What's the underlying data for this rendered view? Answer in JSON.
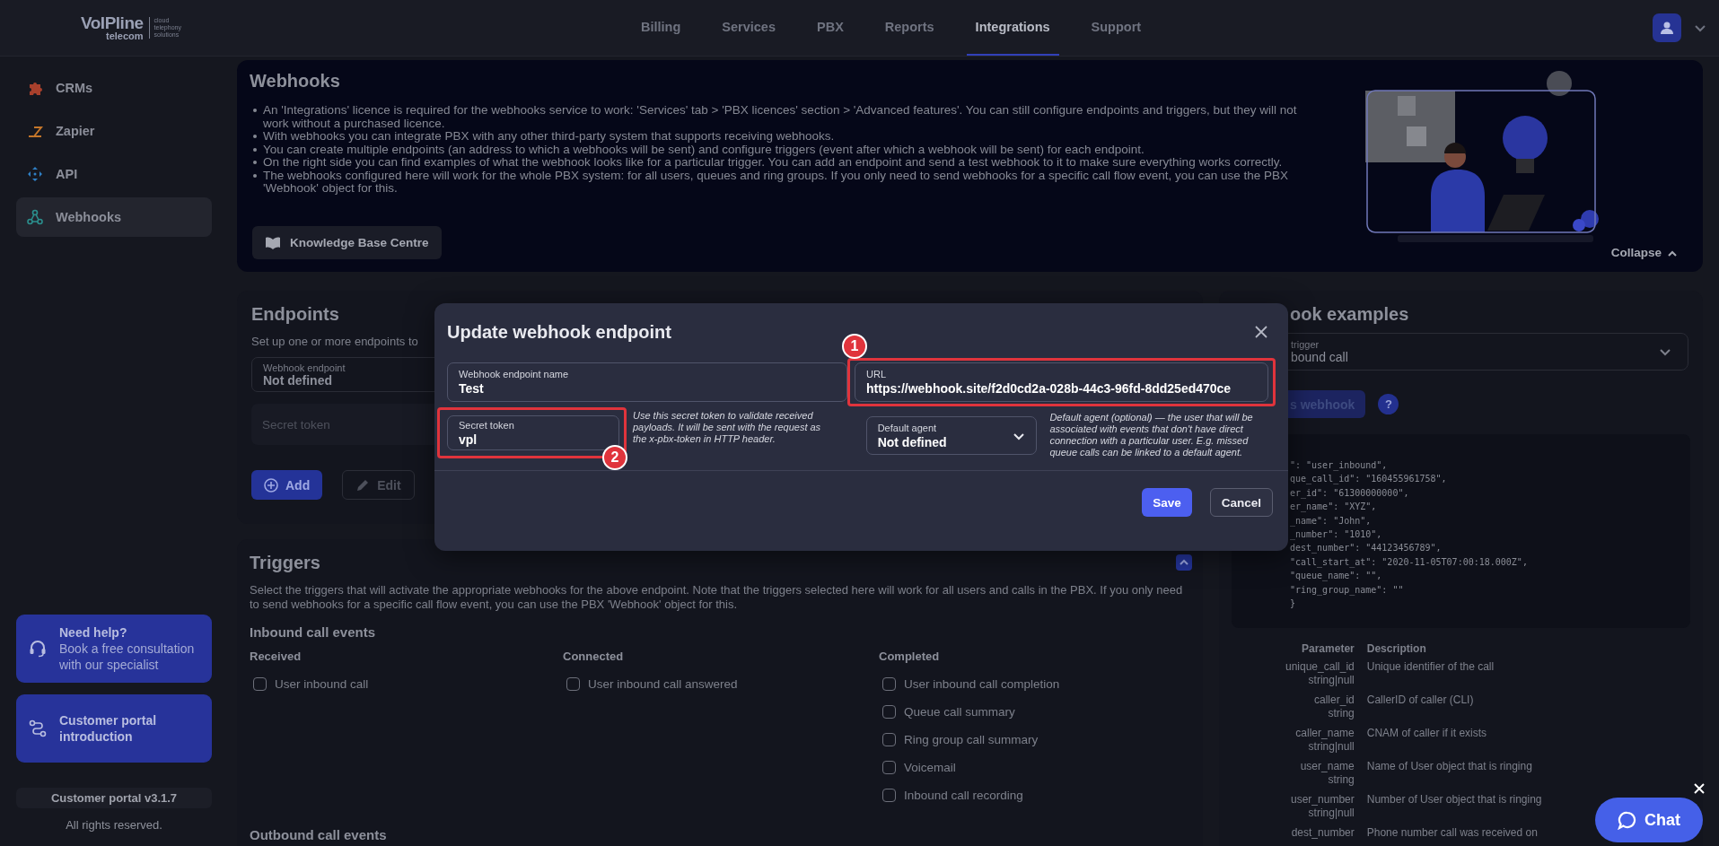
{
  "header": {
    "logo": {
      "name": "VoIPline",
      "sub": "telecom",
      "tagline": "cloud telephony solutions"
    },
    "nav": [
      {
        "label": "Billing",
        "selected": false
      },
      {
        "label": "Services",
        "selected": false
      },
      {
        "label": "PBX",
        "selected": false
      },
      {
        "label": "Reports",
        "selected": false
      },
      {
        "label": "Integrations",
        "selected": true
      },
      {
        "label": "Support",
        "selected": false
      }
    ]
  },
  "sidebar": {
    "items": [
      {
        "label": "CRMs",
        "kind": "puzzle",
        "selected": false
      },
      {
        "label": "Zapier",
        "kind": "zigzag",
        "selected": false
      },
      {
        "label": "API",
        "kind": "arrows",
        "selected": false
      },
      {
        "label": "Webhooks",
        "kind": "nodes",
        "selected": true
      }
    ],
    "help_card": {
      "title": "Need help?",
      "text": "Book a free consultation with our specialist"
    },
    "intro_card": {
      "title": "Customer portal introduction"
    },
    "version": "Customer portal v3.1.7",
    "copyright": "All rights reserved."
  },
  "webhooks": {
    "title": "Webhooks",
    "bullets": [
      "An 'Integrations' licence is required for the webhooks service to work: 'Services' tab > 'PBX licences' section > 'Advanced features'. You can still configure endpoints and triggers, but they will not work without a purchased licence.",
      "With webhooks you can integrate PBX with any other third-party system that supports receiving webhooks.",
      "You can create multiple endpoints (an address to which a webhooks will be sent) and configure triggers (event after which a webhook will be sent) for each endpoint.",
      "On the right side you can find examples of what the webhook looks like for a particular trigger. You can add an endpoint and send a test webhook to it to make sure everything works correctly.",
      "The webhooks configured here will work for the whole PBX system: for all users, queues and ring groups. If you only need to send webhooks for a specific call flow event, you can use the PBX 'Webhook' object for this."
    ],
    "button": "Knowledge Base Centre",
    "collapse": "Collapse",
    "illustration": {
      "kind": "picture"
    }
  },
  "endpoints": {
    "title": "Endpoints",
    "subtitle": "Set up one or more endpoints to",
    "select": {
      "label": "Webhook endpoint",
      "value": "Not defined"
    },
    "secret": {
      "placeholder": "Secret token"
    },
    "buttons": [
      {
        "label": "Add",
        "kind": "add",
        "disabled": false
      },
      {
        "label": "Edit",
        "kind": "edit",
        "disabled": true
      }
    ]
  },
  "examples": {
    "title": "ook examples",
    "trigger_select": {
      "label": "trigger",
      "value": "bound call"
    },
    "send_button": "s webhook",
    "help": "?",
    "code": [
      "\": \"user_inbound\",",
      "que_call_id\": \"160455961758\",",
      "er_id\": \"61300000000\",",
      "er_name\": \"XYZ\",",
      "_name\": \"John\",",
      "_number\": \"1010\",",
      "dest_number\": \"44123456789\",",
      "\"call_start_at\": \"2020-11-05T07:00:18.000Z\",",
      "\"queue_name\": \"\",",
      "\"ring_group_name\": \"\"",
      "}"
    ],
    "params": {
      "columns": [
        "Parameter",
        "Description"
      ],
      "rows": [
        {
          "name": "unique_call_id",
          "type": "string|null",
          "description": "Unique identifier of the call"
        },
        {
          "name": "caller_id",
          "type": "string",
          "description": "CallerID of caller (CLI)"
        },
        {
          "name": "caller_name",
          "type": "string|null",
          "description": "CNAM of caller if it exists"
        },
        {
          "name": "user_name",
          "type": "string",
          "description": "Name of User object that is ringing"
        },
        {
          "name": "user_number",
          "type": "string|null",
          "description": "Number of User object that is ringing"
        },
        {
          "name": "dest_number",
          "description": "Phone number call was received on"
        }
      ]
    }
  },
  "triggers": {
    "title": "Triggers",
    "description": "Select the triggers that will activate the appropriate webhooks for the above endpoint. Note that the triggers selected here will work for all users and calls in the PBX. If you only need to send webhooks for a specific call flow event, you can use the PBX 'Webhook' object for this.",
    "groups": [
      {
        "title": "Inbound call events",
        "columns": [
          {
            "title": "Received",
            "items": [
              {
                "label": "User inbound call",
                "checked": false
              }
            ]
          },
          {
            "title": "Connected",
            "items": [
              {
                "label": "User inbound call answered",
                "checked": false
              }
            ]
          },
          {
            "title": "Completed",
            "items": [
              {
                "label": "User inbound call completion",
                "checked": false
              },
              {
                "label": "Queue call summary",
                "checked": false
              },
              {
                "label": "Ring group call summary",
                "checked": false
              },
              {
                "label": "Voicemail",
                "checked": false
              },
              {
                "label": "Inbound call recording",
                "checked": false
              }
            ]
          }
        ]
      },
      {
        "title": "Outbound call events"
      }
    ]
  },
  "modal": {
    "title": "Update webhook endpoint",
    "fields": [
      {
        "kind": "text",
        "label": "Webhook endpoint name",
        "value": "Test"
      },
      {
        "kind": "text",
        "label": "URL",
        "value": "https://webhook.site/f2d0cd2a-028b-44c3-96fd-8dd25ed470ce",
        "badge": "1"
      },
      {
        "kind": "text",
        "label": "Secret token",
        "value": "vpl",
        "badge": "2",
        "hint": "Use this secret token to validate received payloads. It will be sent with the request as the x-pbx-token in HTTP header."
      },
      {
        "kind": "select",
        "label": "Default agent",
        "value": "Not defined",
        "hint": "Default agent (optional) — the user that will be associated with events that don't have direct connection with a particular user. E.g. missed queue calls can be linked to a default agent."
      }
    ],
    "buttons": [
      {
        "label": "Save",
        "kind": "primary"
      },
      {
        "label": "Cancel",
        "kind": "secondary"
      }
    ]
  },
  "chat": {
    "label": "Chat"
  }
}
